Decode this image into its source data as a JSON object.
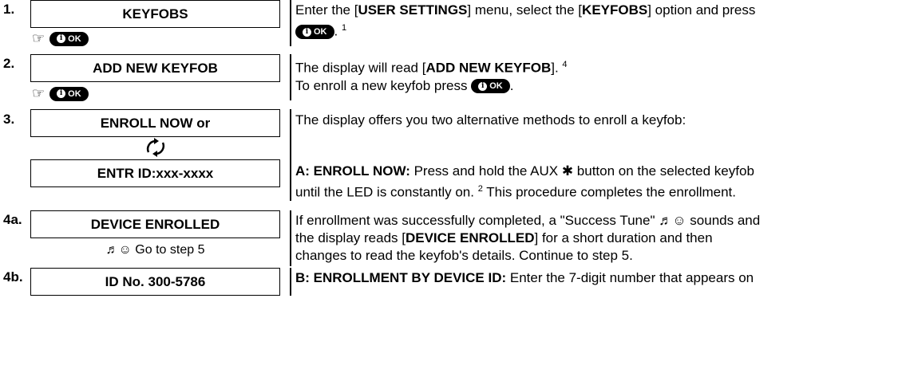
{
  "ok_button": {
    "label": "OK",
    "info_glyph": "i"
  },
  "hand_icon": "☞",
  "steps": {
    "s1": {
      "num": "1.",
      "display": "KEYFOBS",
      "d1": "Enter the [",
      "d1b": "USER SETTINGS",
      "d1c": "] menu, select the [",
      "d1d": "KEYFOBS",
      "d1e": "] option and press",
      "d1f": ". ",
      "sup": "1"
    },
    "s2": {
      "num": "2.",
      "display": "ADD NEW KEYFOB",
      "d1": "The display will read [",
      "d1b": "ADD NEW KEYFOB",
      "d1c": "]. ",
      "sup": "4",
      "d2": "To enroll a new keyfob press",
      "d2b": "."
    },
    "s3": {
      "num": "3.",
      "display": "ENROLL NOW or",
      "display2": "ENTR ID:xxx-xxxx",
      "d1": "The display offers you two alternative methods to enroll a keyfob:",
      "a_label": "A: ENROLL NOW:",
      "a_text": " Press and hold the AUX ✱ button on the selected keyfob",
      "a_text2": "until the LED is constantly on. ",
      "a_sup": "2",
      "a_text3": " This procedure completes the enrollment."
    },
    "s4a": {
      "num": "4a.",
      "display": "DEVICE ENROLLED",
      "sub": "♬☺  Go to step 5",
      "d1": "If enrollment was successfully completed, a \"Success Tune\" ♬☺ sounds and",
      "d2": "the display reads [",
      "d2b": "DEVICE ENROLLED",
      "d2c": "] for a short duration and then",
      "d3": "changes to read the keyfob's details. Continue to step 5."
    },
    "s4b": {
      "num": "4b.",
      "display": "ID No. 300-5786",
      "b_label": "B: ENROLLMENT BY DEVICE ID:",
      "b_text": " Enter the 7-digit number that appears on"
    }
  },
  "toggle_icon": "cycle-arrows-icon"
}
